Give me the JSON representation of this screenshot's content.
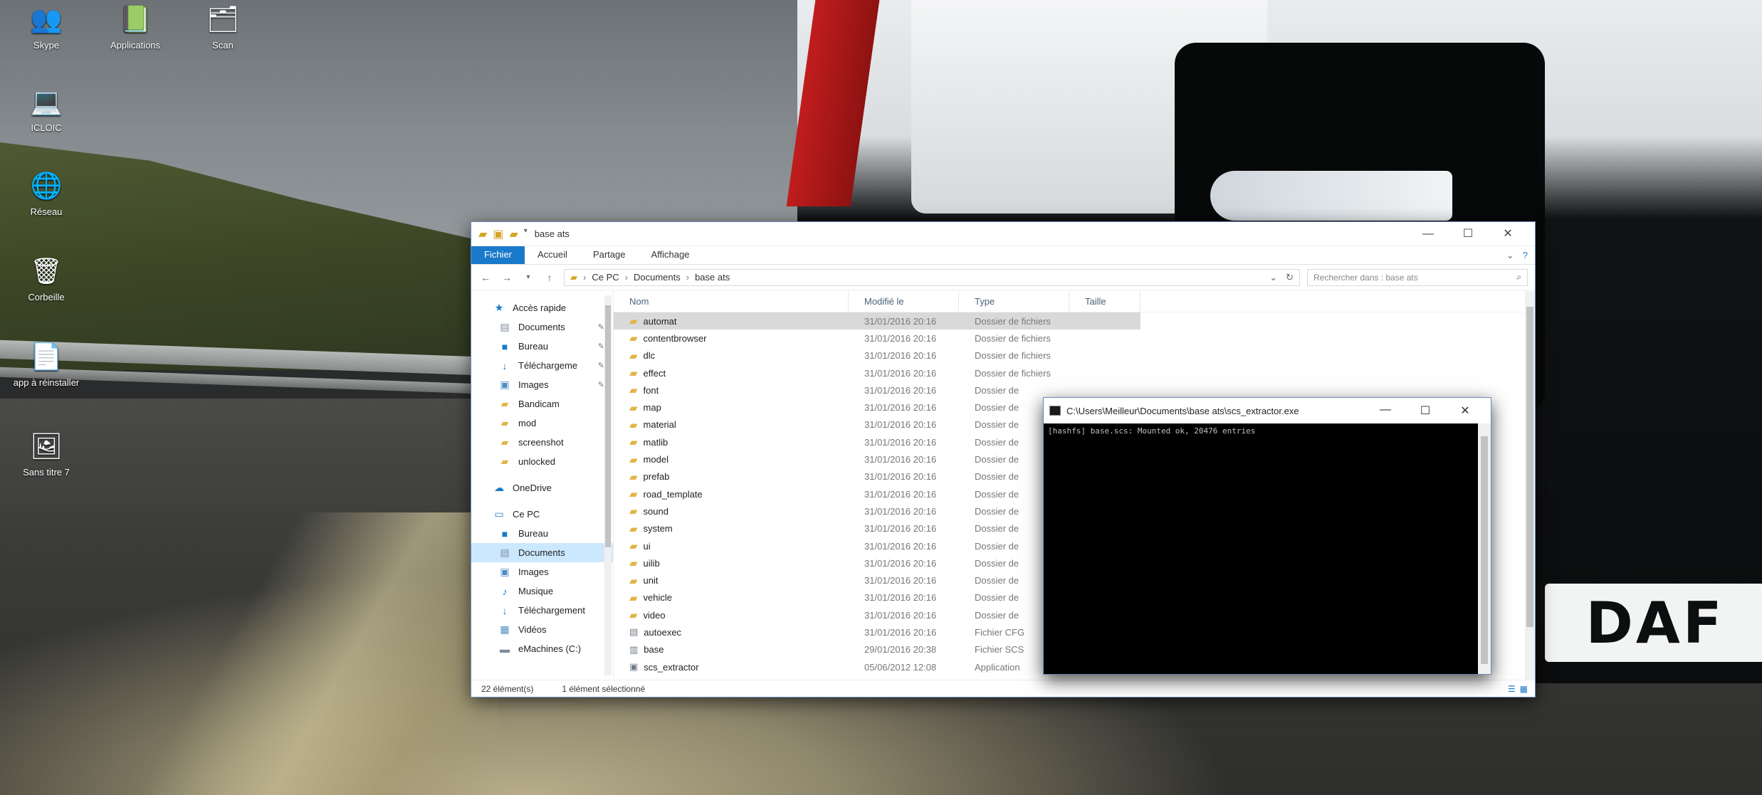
{
  "desktop": {
    "icons": [
      {
        "label": "Skype",
        "glyph": "👥"
      },
      {
        "label": "Applications",
        "glyph": "📗"
      },
      {
        "label": "Scan",
        "glyph": "🗂"
      },
      {
        "label": "ICLOIC",
        "glyph": "💻"
      },
      {
        "label": "Réseau",
        "glyph": "🌐"
      },
      {
        "label": "Corbeille",
        "glyph": "🗑"
      },
      {
        "label": "app à réinstaller",
        "glyph": "📄"
      },
      {
        "label": "Sans titre 7",
        "glyph": "🖼"
      }
    ],
    "wallpaper_brand": "DAF"
  },
  "explorer": {
    "title": "base ats",
    "controls": {
      "minimize": "—",
      "maximize": "☐",
      "close": "✕"
    },
    "ribbon_tabs": [
      "Fichier",
      "Accueil",
      "Partage",
      "Affichage"
    ],
    "address": {
      "parts": [
        "Ce PC",
        "Documents",
        "base ats"
      ],
      "separator": "›"
    },
    "search_placeholder": "Rechercher dans : base ats",
    "nav": {
      "quick_access": "Accès rapide",
      "quick_items": [
        {
          "label": "Documents",
          "icon": "documents-icon",
          "pinned": true
        },
        {
          "label": "Bureau",
          "icon": "desktop-icon",
          "pinned": true
        },
        {
          "label": "Téléchargeme",
          "icon": "download-icon",
          "pinned": true
        },
        {
          "label": "Images",
          "icon": "pictures-icon",
          "pinned": true
        },
        {
          "label": "Bandicam",
          "icon": "folder-icon",
          "pinned": false
        },
        {
          "label": "mod",
          "icon": "folder-icon",
          "pinned": false
        },
        {
          "label": "screenshot",
          "icon": "folder-icon",
          "pinned": false
        },
        {
          "label": "unlocked",
          "icon": "folder-icon",
          "pinned": false
        }
      ],
      "onedrive": "OneDrive",
      "this_pc": "Ce PC",
      "pc_items": [
        {
          "label": "Bureau",
          "icon": "desktop-icon",
          "selected": false
        },
        {
          "label": "Documents",
          "icon": "documents-icon",
          "selected": true
        },
        {
          "label": "Images",
          "icon": "pictures-icon",
          "selected": false
        },
        {
          "label": "Musique",
          "icon": "music-icon",
          "selected": false
        },
        {
          "label": "Téléchargement",
          "icon": "download-icon",
          "selected": false
        },
        {
          "label": "Vidéos",
          "icon": "videos-icon",
          "selected": false
        },
        {
          "label": "eMachines (C:)",
          "icon": "drive-icon",
          "selected": false
        }
      ]
    },
    "columns": [
      "Nom",
      "Modifié le",
      "Type",
      "Taille"
    ],
    "files": [
      {
        "name": "automat",
        "date": "31/01/2016 20:16",
        "type": "Dossier de fichiers",
        "kind": "folder"
      },
      {
        "name": "contentbrowser",
        "date": "31/01/2016 20:16",
        "type": "Dossier de fichiers",
        "kind": "folder"
      },
      {
        "name": "dlc",
        "date": "31/01/2016 20:16",
        "type": "Dossier de fichiers",
        "kind": "folder"
      },
      {
        "name": "effect",
        "date": "31/01/2016 20:16",
        "type": "Dossier de fichiers",
        "kind": "folder"
      },
      {
        "name": "font",
        "date": "31/01/2016 20:16",
        "type": "Dossier de",
        "kind": "folder"
      },
      {
        "name": "map",
        "date": "31/01/2016 20:16",
        "type": "Dossier de",
        "kind": "folder"
      },
      {
        "name": "material",
        "date": "31/01/2016 20:16",
        "type": "Dossier de",
        "kind": "folder"
      },
      {
        "name": "matlib",
        "date": "31/01/2016 20:16",
        "type": "Dossier de",
        "kind": "folder"
      },
      {
        "name": "model",
        "date": "31/01/2016 20:16",
        "type": "Dossier de",
        "kind": "folder"
      },
      {
        "name": "prefab",
        "date": "31/01/2016 20:16",
        "type": "Dossier de",
        "kind": "folder"
      },
      {
        "name": "road_template",
        "date": "31/01/2016 20:16",
        "type": "Dossier de",
        "kind": "folder"
      },
      {
        "name": "sound",
        "date": "31/01/2016 20:16",
        "type": "Dossier de",
        "kind": "folder"
      },
      {
        "name": "system",
        "date": "31/01/2016 20:16",
        "type": "Dossier de",
        "kind": "folder"
      },
      {
        "name": "ui",
        "date": "31/01/2016 20:16",
        "type": "Dossier de",
        "kind": "folder"
      },
      {
        "name": "uilib",
        "date": "31/01/2016 20:16",
        "type": "Dossier de",
        "kind": "folder"
      },
      {
        "name": "unit",
        "date": "31/01/2016 20:16",
        "type": "Dossier de",
        "kind": "folder"
      },
      {
        "name": "vehicle",
        "date": "31/01/2016 20:16",
        "type": "Dossier de",
        "kind": "folder"
      },
      {
        "name": "video",
        "date": "31/01/2016 20:16",
        "type": "Dossier de",
        "kind": "folder"
      },
      {
        "name": "autoexec",
        "date": "31/01/2016 20:16",
        "type": "Fichier CFG",
        "kind": "file"
      },
      {
        "name": "base",
        "date": "29/01/2016 20:38",
        "type": "Fichier SCS",
        "kind": "archive"
      },
      {
        "name": "scs_extractor",
        "date": "05/06/2012 12:08",
        "type": "Application",
        "kind": "app"
      }
    ],
    "status": {
      "count": "22 élément(s)",
      "selection": "1 élément sélectionné"
    }
  },
  "console": {
    "title": "C:\\Users\\Meilleur\\Documents\\base ats\\scs_extractor.exe",
    "controls": {
      "minimize": "—",
      "maximize": "☐",
      "close": "✕"
    },
    "output": "[hashfs] base.scs: Mounted ok, 20476 entries"
  }
}
